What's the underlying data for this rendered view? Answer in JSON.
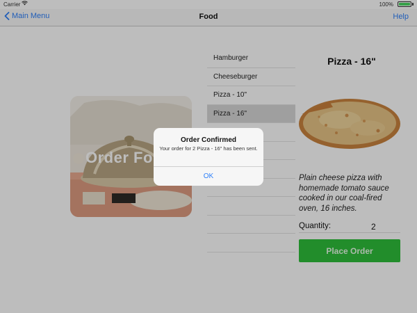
{
  "status_bar": {
    "carrier": "Carrier",
    "time": "",
    "battery_percent": "100%"
  },
  "nav": {
    "back_label": "Main Menu",
    "title": "Food",
    "help_label": "Help"
  },
  "hero": {
    "label": "Order Fo"
  },
  "menu": {
    "items": [
      {
        "label": "Hamburger"
      },
      {
        "label": "Cheeseburger"
      },
      {
        "label": "Pizza - 10\""
      },
      {
        "label": "Pizza - 16\""
      }
    ],
    "selected_index": 3
  },
  "detail": {
    "title": "Pizza - 16\"",
    "description": "Plain cheese pizza with homemade tomato sauce cooked in our coal-fired oven, 16 inches.",
    "quantity_label": "Quantity:",
    "quantity_value": "2",
    "order_button_label": "Place Order"
  },
  "alert": {
    "title": "Order Confirmed",
    "message": "Your order for 2 Pizza - 16\" has been sent.",
    "ok_label": "OK"
  },
  "colors": {
    "accent": "#2d7ff9",
    "order_button": "#2fbf3a",
    "battery": "#4cd964"
  }
}
